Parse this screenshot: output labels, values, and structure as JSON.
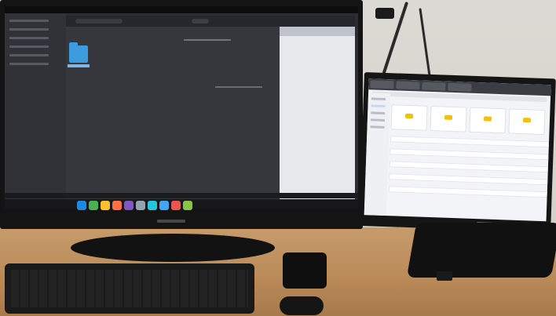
{
  "scene": {
    "colors": {
      "wall": "#d7d4cc",
      "desk": "#c29a6a",
      "left_screen": "#2c2d33",
      "right_screen": "#f3f4f7",
      "folder": "#3d9be0",
      "taskbar": "#17181c"
    }
  }
}
